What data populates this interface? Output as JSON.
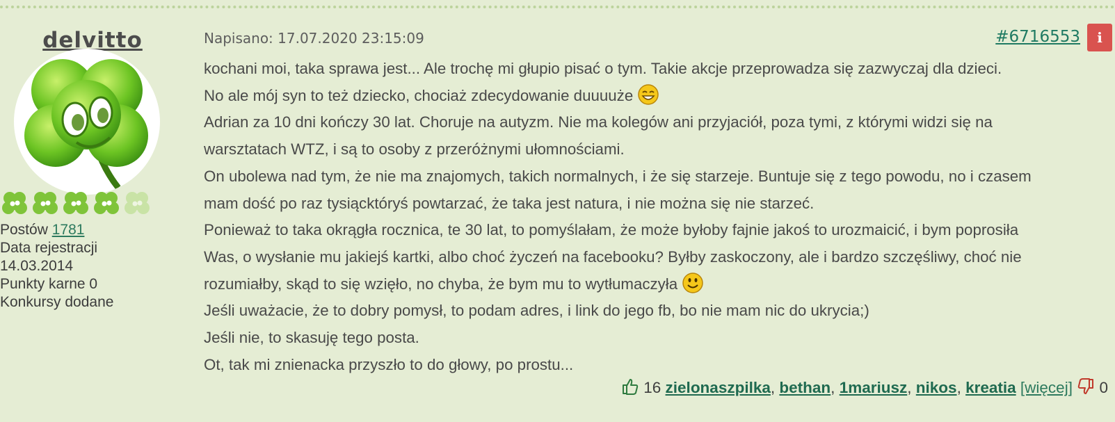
{
  "post": {
    "author": "delvitto",
    "posted_label": "Napisano: 17.07.2020 23:15:09",
    "post_number": "#6716553",
    "info_icon_label": "i",
    "rank_icons": [
      "clover-icon",
      "clover-icon",
      "clover-icon",
      "clover-icon",
      "faded-clover-icon"
    ],
    "stats": {
      "posts_label": "Postów",
      "posts_count": "1781",
      "registration_label": "Data rejestracji",
      "registration_date": "14.03.2014",
      "penalty_label": "Punkty karne 0",
      "contests_label": "Konkursy dodane"
    },
    "lines": [
      "kochani moi, taka sprawa jest... Ale trochę mi głupio pisać o tym. Takie akcje przeprowadza się zazwyczaj dla dzieci.",
      "No ale mój syn to też dziecko, chociaż zdecydowanie duuuuże",
      "Adrian za 10 dni kończy 30 lat. Choruje na autyzm. Nie ma kolegów ani przyjaciół, poza tymi, z którymi widzi się na",
      "warsztatach WTZ, i są to osoby z przeróżnymi ułomnościami.",
      "On ubolewa nad tym, że nie ma znajomych, takich normalnych, i że się starzeje. Buntuje się z tego powodu, no i czasem",
      "mam dość po raz tysiącktóryś powtarzać, że taka jest natura, i nie można się nie starzeć.",
      "Ponieważ to taka okrągła rocznica, te 30 lat, to pomyślałam, że może byłoby fajnie jakoś to urozmaicić, i bym poprosiła",
      "Was, o wysłanie mu jakiejś kartki, albo choć życzeń na facebooku? Byłby zaskoczony, ale i bardzo szczęśliwy, choć nie",
      "rozumiałby, skąd to się wzięło, no chyba, że bym mu to wytłumaczyła",
      "Jeśli uważacie, że to dobry pomysł, to podam adres, i link do jego fb, bo nie mam nic do ukrycia;)",
      "Jeśli nie, to skasuję tego posta.",
      "Ot, tak mi znienacka przyszło to do głowy, po prostu..."
    ],
    "reactions": {
      "likes_count": "16",
      "likers": [
        "zielonaszpilka",
        "bethan",
        "1mariusz",
        "nikos",
        "kreatia"
      ],
      "separator": ",",
      "more_label": "[więcej]",
      "dislikes_count": "0"
    }
  }
}
